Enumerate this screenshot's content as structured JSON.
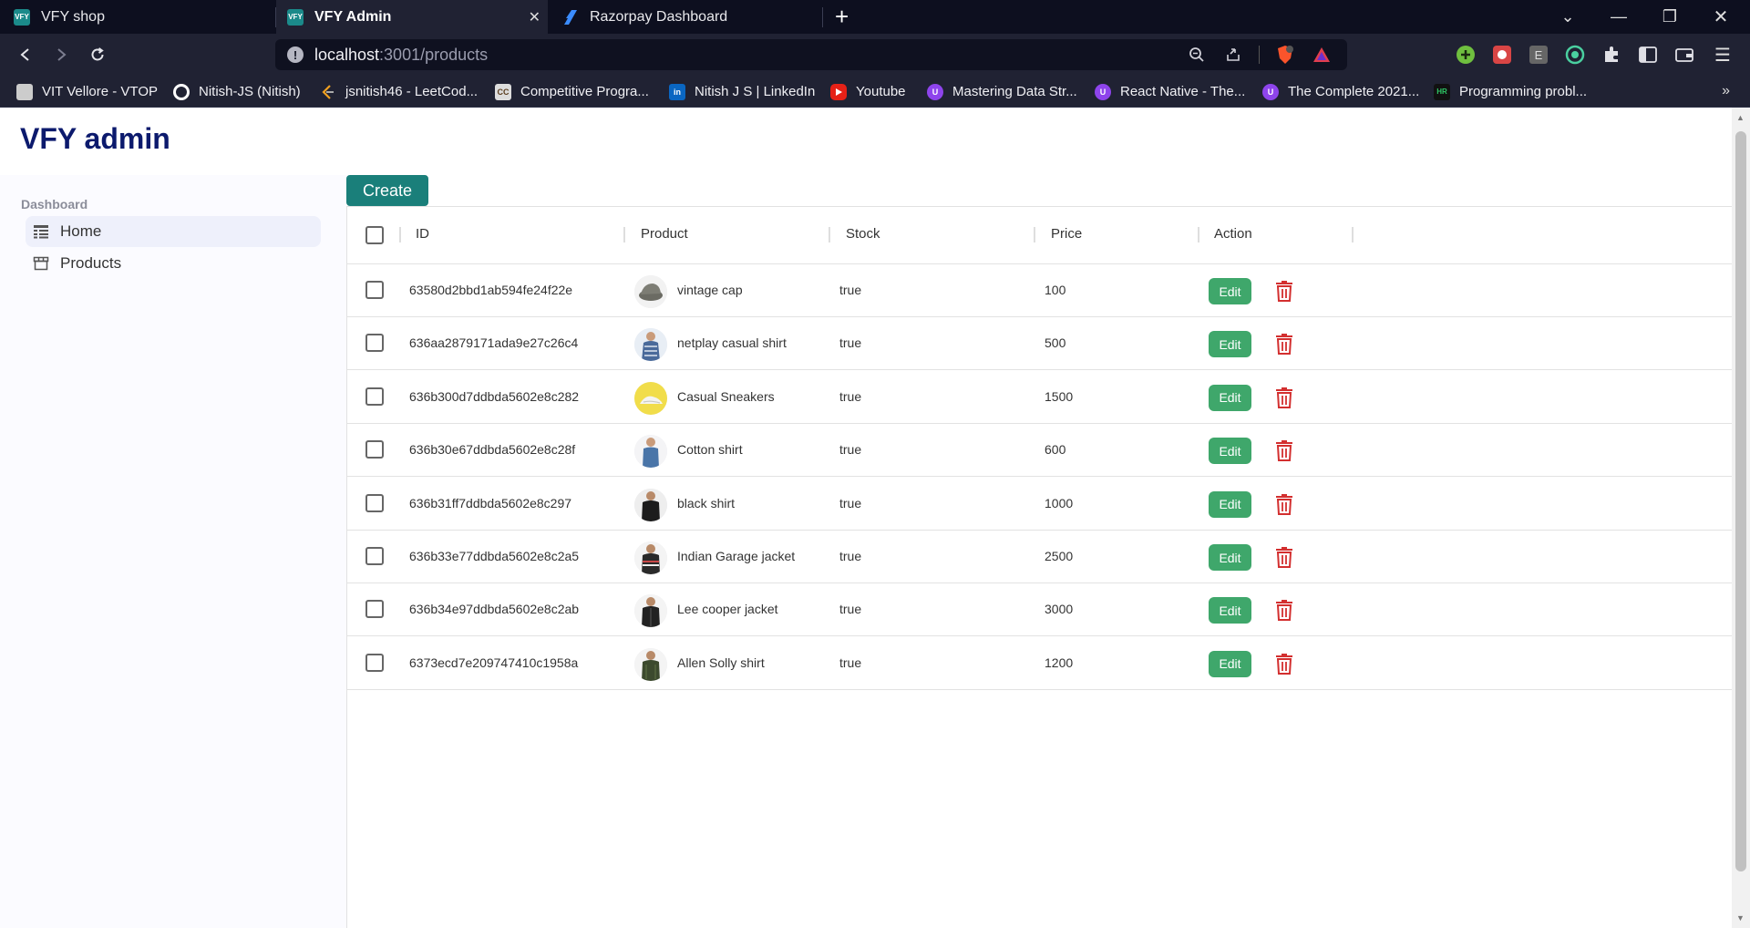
{
  "browser": {
    "tabs": [
      {
        "label": "VFY shop",
        "favicon": "VFY",
        "active": false
      },
      {
        "label": "VFY Admin",
        "favicon": "VFY",
        "active": true
      },
      {
        "label": "Razorpay Dashboard",
        "favicon": "razorpay-icon",
        "active": false
      }
    ],
    "url_host": "localhost",
    "url_path": ":3001/products",
    "bookmarks": [
      {
        "label": "VIT Vellore - VTOP",
        "icon": "vit-icon"
      },
      {
        "label": "Nitish-JS (Nitish)",
        "icon": "github-icon"
      },
      {
        "label": "jsnitish46 - LeetCod...",
        "icon": "leetcode-icon"
      },
      {
        "label": "Competitive Progra...",
        "icon": "codechef-icon",
        "icon_text": "CC"
      },
      {
        "label": "Nitish J S | LinkedIn",
        "icon": "linkedin-icon",
        "icon_text": "in"
      },
      {
        "label": "Youtube",
        "icon": "youtube-icon"
      },
      {
        "label": "Mastering Data Str...",
        "icon": "udemy-icon",
        "icon_text": "U"
      },
      {
        "label": "React Native - The...",
        "icon": "udemy-icon",
        "icon_text": "U"
      },
      {
        "label": "The Complete 2021...",
        "icon": "udemy-icon",
        "icon_text": "U"
      },
      {
        "label": "Programming probl...",
        "icon": "hackerrank-icon",
        "icon_text": "HR"
      }
    ]
  },
  "app": {
    "brand": "VFY admin",
    "sidebar": {
      "heading": "Dashboard",
      "items": [
        {
          "label": "Home",
          "icon": "table-icon",
          "active": true
        },
        {
          "label": "Products",
          "icon": "store-icon",
          "active": false
        }
      ]
    },
    "create_label": "Create",
    "table": {
      "columns": [
        "ID",
        "Product",
        "Stock",
        "Price",
        "Action"
      ],
      "edit_label": "Edit",
      "rows": [
        {
          "id": "63580d2bbd1ab594fe24f22e",
          "product": "vintage cap",
          "stock": "true",
          "price": "100"
        },
        {
          "id": "636aa2879171ada9e27c26c4",
          "product": "netplay casual shirt",
          "stock": "true",
          "price": "500"
        },
        {
          "id": "636b300d7ddbda5602e8c282",
          "product": "Casual Sneakers",
          "stock": "true",
          "price": "1500"
        },
        {
          "id": "636b30e67ddbda5602e8c28f",
          "product": "Cotton shirt",
          "stock": "true",
          "price": "600"
        },
        {
          "id": "636b31ff7ddbda5602e8c297",
          "product": "black shirt",
          "stock": "true",
          "price": "1000"
        },
        {
          "id": "636b33e77ddbda5602e8c2a5",
          "product": "Indian Garage jacket",
          "stock": "true",
          "price": "2500"
        },
        {
          "id": "636b34e97ddbda5602e8c2ab",
          "product": "Lee cooper jacket",
          "stock": "true",
          "price": "3000"
        },
        {
          "id": "6373ecd7e209747410c1958a",
          "product": "Allen Solly shirt",
          "stock": "true",
          "price": "1200"
        }
      ]
    }
  },
  "colors": {
    "brand": "#0c1a6d",
    "create_button": "#1a7f7a",
    "edit_button": "#3fa76b",
    "delete_icon": "#d32f2f"
  }
}
